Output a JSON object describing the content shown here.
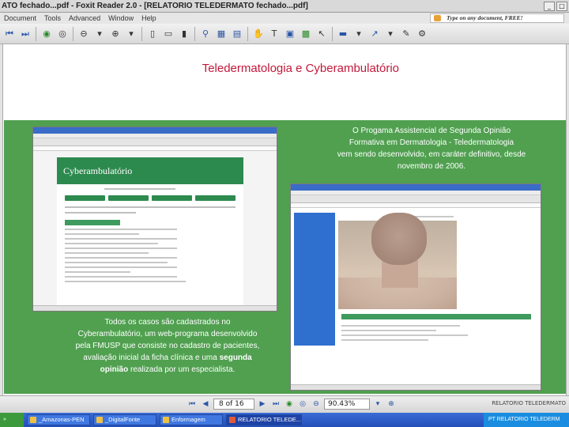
{
  "window": {
    "title": "ATO  fechado...pdf - Foxit Reader 2.0 - [RELATORIO TELEDERMATO  fechado...pdf]"
  },
  "menu": {
    "items": [
      "Document",
      "Tools",
      "Advanced",
      "Window",
      "Help"
    ],
    "ad_text": "Type on any document, FREE!"
  },
  "toolbar": {
    "icons": [
      "first-page-icon",
      "last-page-icon",
      "back-icon",
      "forward-icon",
      "zoom-out-icon",
      "zoom-in-icon",
      "single-page-icon",
      "continuous-icon",
      "facing-icon",
      "binoculars-icon",
      "column-icon",
      "hand-icon",
      "text-select-icon",
      "snapshot-icon",
      "image-icon",
      "select-icon",
      "highlight-icon",
      "arrow-tool-icon",
      "typewriter-icon"
    ]
  },
  "slide": {
    "title": "Teledermatologia e Cyberambulatório",
    "left_shot_logo": "Cyberambulatório",
    "caption_right": [
      "O Progama Assistencial de Segunda Opinião",
      "Formativa em Dermatologia - Teledermatologia",
      "vem sendo desenvolvido, em caráter definitivo, desde",
      "novembro de 2006."
    ],
    "caption_left": [
      "Todos os casos são cadastrados no",
      "Cyberambulatório, um web-programa desenvolvido",
      "pela FMUSP que consiste no cadastro de pacientes,",
      "avaliação inicial da ficha clínica e uma"
    ],
    "caption_left_bold": "segunda",
    "caption_left_last_bold": "opinião",
    "caption_left_last_rest": " realizada por um especialista."
  },
  "status": {
    "page": "8 of 16",
    "zoom": "90.43%",
    "right_text": "RELATORIO TELEDERMATO"
  },
  "taskbar": {
    "tasks": [
      "_Amazonas-PEN",
      "_DigitalFonte",
      "Enformagem",
      "RELATORIO TELEDE..."
    ],
    "tray": "PT  RELATORIO TELEDERM"
  }
}
